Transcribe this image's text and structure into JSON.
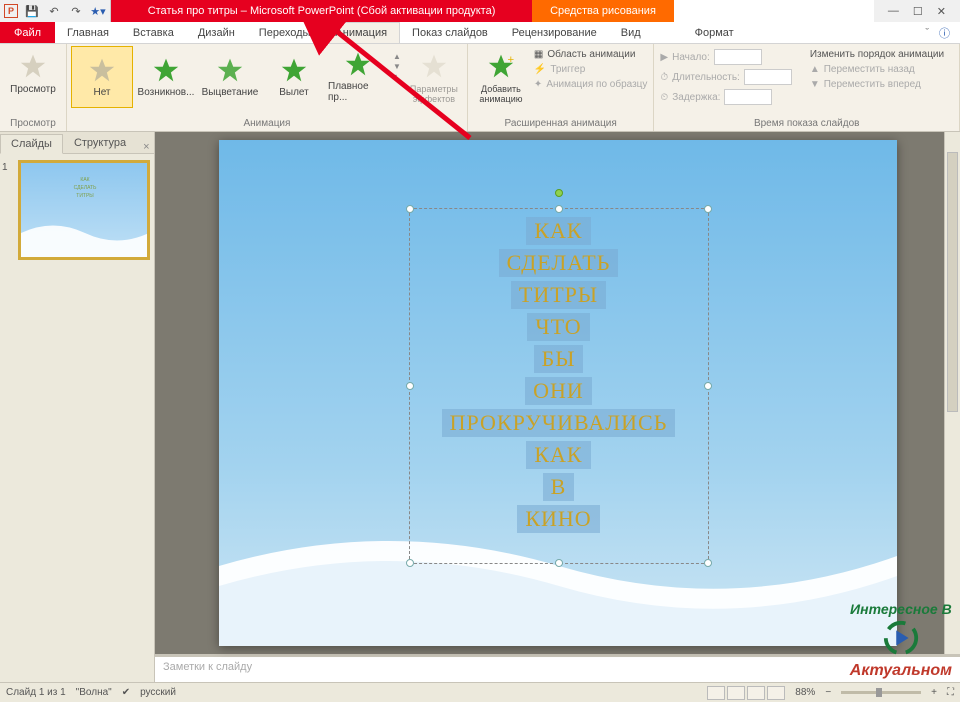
{
  "titlebar": {
    "title": "Статья про титры – Microsoft PowerPoint (Сбой активации продукта)",
    "tools_tab": "Средства рисования"
  },
  "ribbon_tabs": {
    "file": "Файл",
    "home": "Главная",
    "insert": "Вставка",
    "design": "Дизайн",
    "transitions": "Переходы",
    "animations": "Анимация",
    "slideshow": "Показ слайдов",
    "review": "Рецензирование",
    "view": "Вид",
    "format": "Формат"
  },
  "ribbon": {
    "preview_btn": "Просмотр",
    "preview_group": "Просмотр",
    "anim_none": "Нет",
    "anim_appear": "Возникнов...",
    "anim_fade": "Выцветание",
    "anim_flyin": "Вылет",
    "anim_float": "Плавное пр...",
    "effect_opts": "Параметры эффектов",
    "anim_group": "Анимация",
    "add_anim": "Добавить анимацию",
    "anim_pane": "Область анимации",
    "trigger": "Триггер",
    "anim_painter": "Анимация по образцу",
    "adv_group": "Расширенная анимация",
    "start": "Начало:",
    "duration": "Длительность:",
    "delay": "Задержка:",
    "reorder": "Изменить порядок анимации",
    "move_earlier": "Переместить назад",
    "move_later": "Переместить вперед",
    "timing_group": "Время показа слайдов"
  },
  "left_panel": {
    "slides_tab": "Слайды",
    "outline_tab": "Структура",
    "slide_num": "1"
  },
  "slide_text": [
    "КАК",
    "СДЕЛАТЬ",
    "ТИТРЫ",
    "ЧТО",
    "БЫ",
    "ОНИ",
    "ПРОКРУЧИВАЛИСЬ",
    "КАК",
    "В",
    "КИНО"
  ],
  "notes": {
    "placeholder": "Заметки к слайду"
  },
  "status": {
    "slide_info": "Слайд 1 из 1",
    "theme": "\"Волна\"",
    "lang": "русский",
    "zoom": "88%"
  },
  "watermark": {
    "line1": "Интересное В",
    "line2": "Актуальном"
  }
}
